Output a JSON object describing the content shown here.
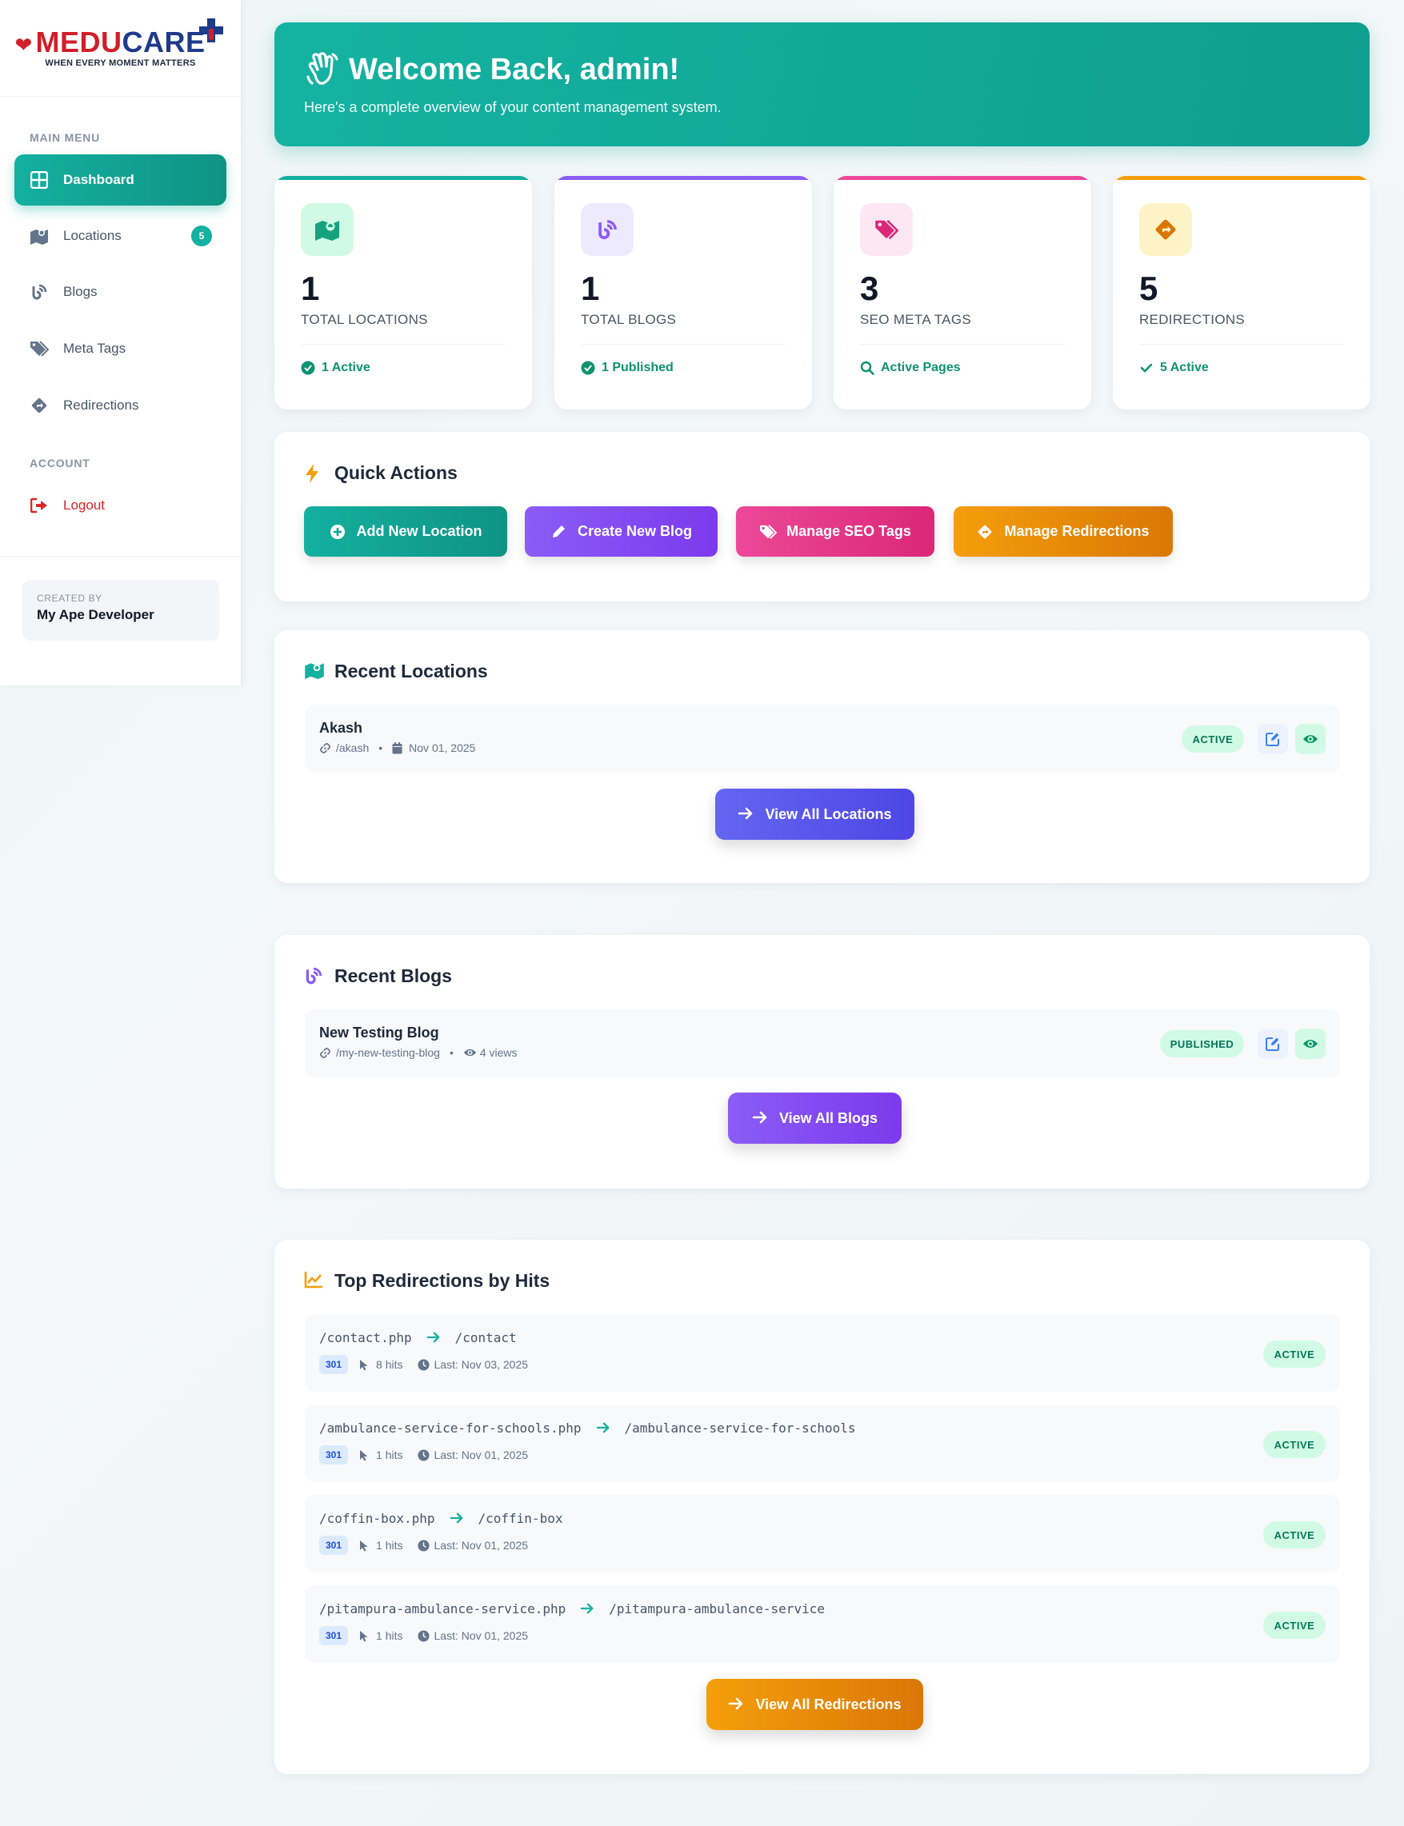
{
  "brand": {
    "name_part1": "MEDU",
    "name_part2": "CARE",
    "tagline": "WHEN EVERY MOMENT MATTERS"
  },
  "sidebar": {
    "main_label": "MAIN MENU",
    "items": [
      {
        "label": "Dashboard",
        "icon": "dashboard-icon",
        "active": true
      },
      {
        "label": "Locations",
        "icon": "map-icon",
        "badge": "5"
      },
      {
        "label": "Blogs",
        "icon": "blog-icon"
      },
      {
        "label": "Meta Tags",
        "icon": "tags-icon"
      },
      {
        "label": "Redirections",
        "icon": "redirect-icon"
      }
    ],
    "account_label": "ACCOUNT",
    "logout_label": "Logout",
    "created_by_label": "CREATED BY",
    "created_by_name": "My Ape Developer"
  },
  "welcome": {
    "title": "Welcome Back, admin!",
    "subtitle": "Here's a complete overview of your content management system."
  },
  "stats": [
    {
      "value": "1",
      "label": "TOTAL LOCATIONS",
      "foot": "1 Active",
      "accent": "#14b0a0"
    },
    {
      "value": "1",
      "label": "TOTAL BLOGS",
      "foot": "1 Published",
      "accent": "#8b5cf6"
    },
    {
      "value": "3",
      "label": "SEO META TAGS",
      "foot": "Active Pages",
      "accent": "#ec4899"
    },
    {
      "value": "5",
      "label": "REDIRECTIONS",
      "foot": "5 Active",
      "accent": "#f59e0b"
    }
  ],
  "quick_actions": {
    "title": "Quick Actions",
    "buttons": [
      {
        "label": "Add New Location"
      },
      {
        "label": "Create New Blog"
      },
      {
        "label": "Manage SEO Tags"
      },
      {
        "label": "Manage Redirections"
      }
    ]
  },
  "recent_locations": {
    "title": "Recent Locations",
    "items": [
      {
        "name": "Akash",
        "slug": "/akash",
        "date": "Nov 01, 2025",
        "status": "ACTIVE"
      }
    ],
    "view_all": "View All Locations"
  },
  "recent_blogs": {
    "title": "Recent Blogs",
    "items": [
      {
        "name": "New Testing Blog",
        "slug": "/my-new-testing-blog",
        "views": "4 views",
        "status": "PUBLISHED"
      }
    ],
    "view_all": "View All Blogs"
  },
  "top_redirections": {
    "title": "Top Redirections by Hits",
    "items": [
      {
        "from": "/contact.php",
        "to": "/contact",
        "code": "301",
        "hits": "8 hits",
        "last": "Last: Nov 03, 2025",
        "status": "ACTIVE"
      },
      {
        "from": "/ambulance-service-for-schools.php",
        "to": "/ambulance-service-for-schools",
        "code": "301",
        "hits": "1 hits",
        "last": "Last: Nov 01, 2025",
        "status": "ACTIVE"
      },
      {
        "from": "/coffin-box.php",
        "to": "/coffin-box",
        "code": "301",
        "hits": "1 hits",
        "last": "Last: Nov 01, 2025",
        "status": "ACTIVE"
      },
      {
        "from": "/pitampura-ambulance-service.php",
        "to": "/pitampura-ambulance-service",
        "code": "301",
        "hits": "1 hits",
        "last": "Last: Nov 01, 2025",
        "status": "ACTIVE"
      }
    ],
    "view_all": "View All Redirections"
  }
}
